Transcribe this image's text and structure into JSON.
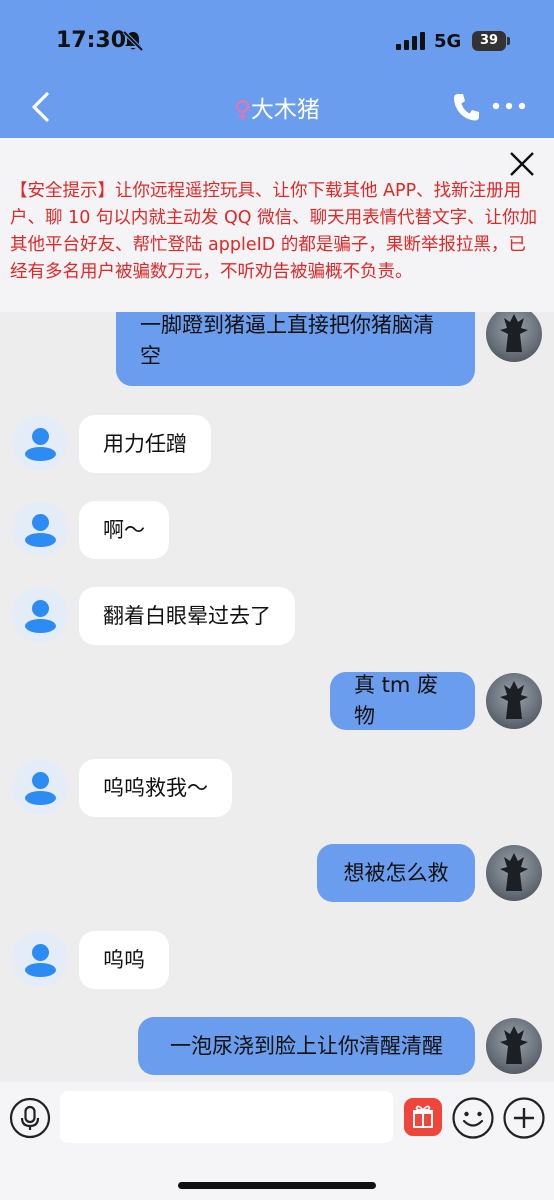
{
  "status_bar": {
    "time": "17:30",
    "network": "5G",
    "battery": "39",
    "icons": [
      "bell-slash-icon",
      "signal-icon"
    ]
  },
  "header": {
    "gender_symbol": "♀",
    "contact_name": "大木猪",
    "icons": [
      "back-chevron-icon",
      "phone-icon",
      "more-icon"
    ]
  },
  "warning": {
    "text": "【安全提示】让你远程遥控玩具、让你下载其他 APP、找新注册用户、聊 10 句以内就主动发 QQ 微信、聊天用表情代替文字、让你加其他平台好友、帮忙登陆 appleID 的都是骗子，果断举报拉黑，已经有多名用户被骗数万元，不听劝告被骗概不负责。",
    "color": "#e12828"
  },
  "messages": [
    {
      "side": "right",
      "lines": [
        "一脚蹬到猪逼上直接把你猪脑清",
        "空"
      ]
    },
    {
      "side": "left",
      "lines": [
        "用力任蹭"
      ]
    },
    {
      "side": "left",
      "lines": [
        "啊～"
      ]
    },
    {
      "side": "left",
      "lines": [
        "翻着白眼晕过去了"
      ]
    },
    {
      "side": "right",
      "lines": [
        "真 tm 废物"
      ]
    },
    {
      "side": "left",
      "lines": [
        "呜呜救我～"
      ]
    },
    {
      "side": "right",
      "lines": [
        "想被怎么救"
      ]
    },
    {
      "side": "left",
      "lines": [
        "呜呜"
      ]
    },
    {
      "side": "right",
      "lines": [
        "一泡尿浇到脸上让你清醒清醒"
      ]
    }
  ],
  "input_bar": {
    "placeholder": "",
    "icons": [
      "microphone-icon",
      "gift-icon",
      "emoji-icon",
      "plus-icon"
    ]
  },
  "colors": {
    "header_bg": "#6a9ded",
    "own_bubble": "#6a9ded",
    "other_bubble": "#ffffff",
    "chat_bg": "#ededed",
    "avatar_accent": "#2c8cf4"
  }
}
